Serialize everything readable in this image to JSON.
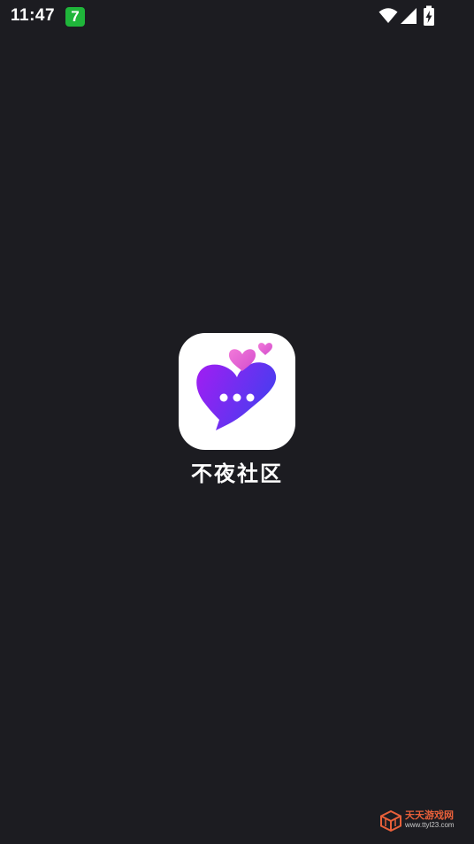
{
  "status_bar": {
    "time": "11:47",
    "notification_badge": "7",
    "icons": [
      "wifi-icon",
      "signal-icon",
      "battery-charging-icon"
    ]
  },
  "splash": {
    "app_icon": "heart-chat-logo-icon",
    "app_name": "不夜社区"
  },
  "watermark": {
    "logo_icon": "cube-logo-icon",
    "name": "天天游戏网",
    "url": "www.ttyl23.com"
  },
  "colors": {
    "background": "#1c1c21",
    "badge": "#1fb53a",
    "logo_gradient_start": "#a21df2",
    "logo_gradient_end": "#4b3cf0",
    "hearts": "#e25fd2",
    "watermark": "#e9603a"
  }
}
